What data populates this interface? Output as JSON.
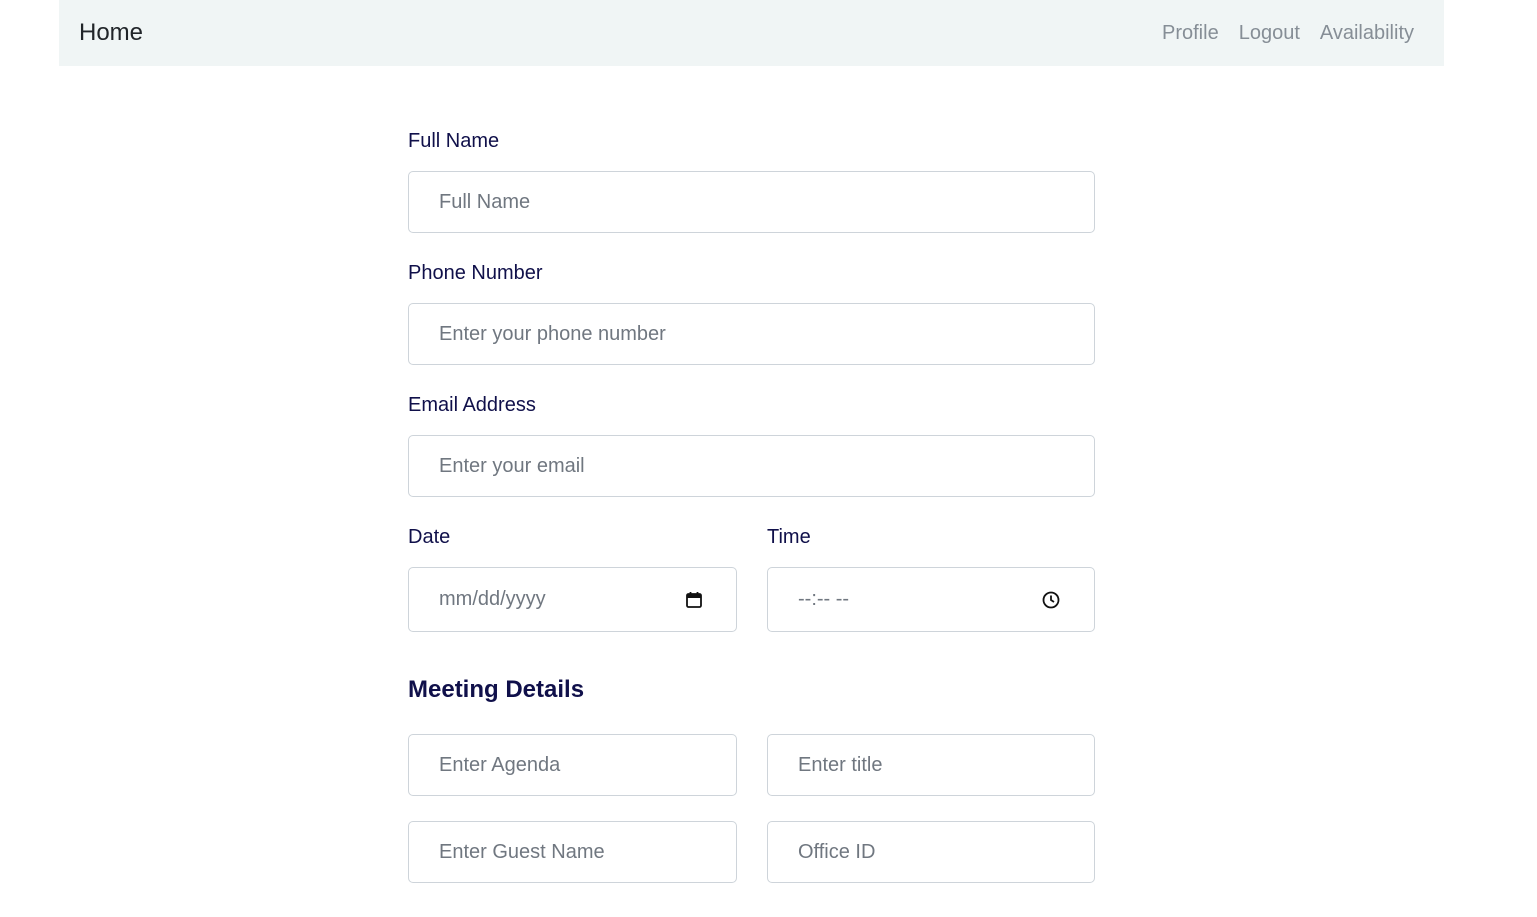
{
  "nav": {
    "brand": "Home",
    "links": [
      "Profile",
      "Logout",
      "Availability"
    ]
  },
  "form": {
    "full_name": {
      "label": "Full Name",
      "placeholder": "Full Name"
    },
    "phone": {
      "label": "Phone Number",
      "placeholder": "Enter your phone number"
    },
    "email": {
      "label": "Email Address",
      "placeholder": "Enter your email"
    },
    "date": {
      "label": "Date",
      "placeholder": "mm/dd/yyyy"
    },
    "time": {
      "label": "Time",
      "placeholder": "--:-- --"
    }
  },
  "meeting": {
    "title": "Meeting Details",
    "agenda_placeholder": "Enter Agenda",
    "title_placeholder": "Enter title",
    "guest_placeholder": "Enter Guest Name",
    "office_placeholder": "Office ID"
  },
  "icons": {
    "date": "calendar-icon",
    "time": "clock-icon"
  }
}
